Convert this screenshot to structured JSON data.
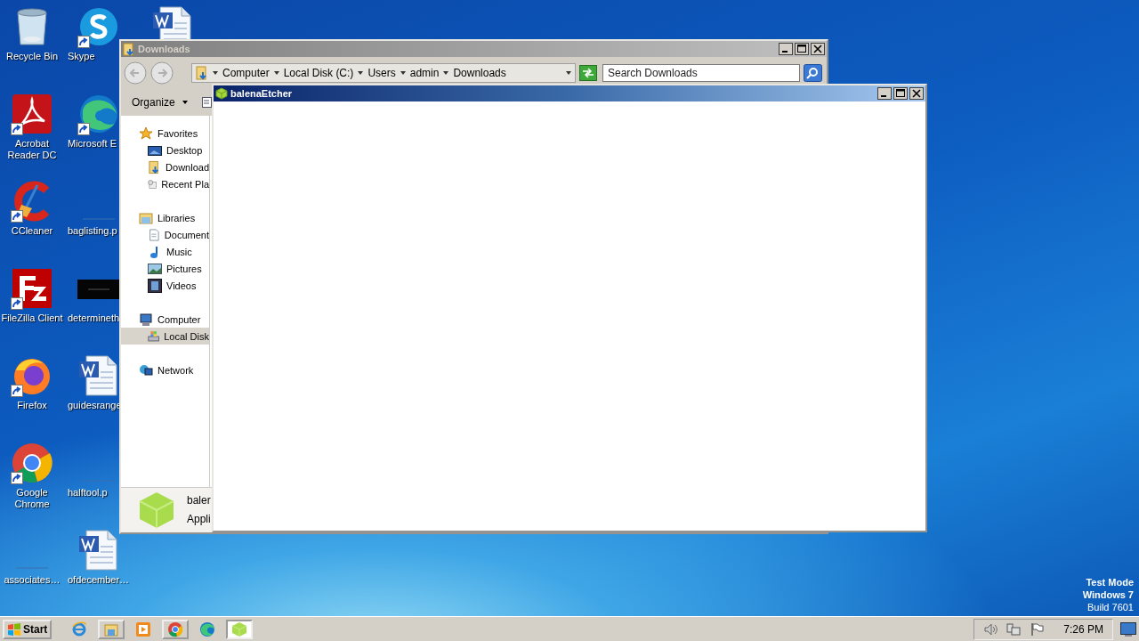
{
  "desktop_icons": [
    {
      "label": "Recycle Bin",
      "kind": "recycle",
      "shortcut": false
    },
    {
      "label": "Acrobat Reader DC",
      "kind": "pdf",
      "shortcut": true
    },
    {
      "label": "CCleaner",
      "kind": "ccleaner",
      "shortcut": true
    },
    {
      "label": "FileZilla Client",
      "kind": "filezilla",
      "shortcut": true
    },
    {
      "label": "Firefox",
      "kind": "firefox",
      "shortcut": true
    },
    {
      "label": "Google Chrome",
      "kind": "chrome",
      "shortcut": true
    },
    {
      "label": "associates…",
      "kind": "blank",
      "shortcut": false
    },
    {
      "label": "Skype",
      "kind": "skype",
      "shortcut": true
    },
    {
      "label": "Microsoft E",
      "kind": "edge",
      "shortcut": true
    },
    {
      "label": "baglisting.p",
      "kind": "blank",
      "shortcut": false
    },
    {
      "label": "determineth",
      "kind": "thumb",
      "shortcut": false
    },
    {
      "label": "guidesrange",
      "kind": "word",
      "shortcut": false
    },
    {
      "label": "halftool.p",
      "kind": "blank",
      "shortcut": false
    },
    {
      "label": "ofdecember…",
      "kind": "word",
      "shortcut": false
    },
    {
      "kind": "word",
      "shortcut": false
    }
  ],
  "explorer": {
    "title": "Downloads",
    "active": false,
    "breadcrumb": [
      "Computer",
      "Local Disk (C:)",
      "Users",
      "admin",
      "Downloads"
    ],
    "search": {
      "placeholder": "Search Downloads"
    },
    "toolbar": {
      "organize": "Organize"
    },
    "nav": [
      {
        "label": "Favorites",
        "kind": "star",
        "selected": false,
        "children": [
          {
            "label": "Desktop",
            "kind": "desktop",
            "selected": false
          },
          {
            "label": "Download",
            "kind": "folder",
            "selected": false
          },
          {
            "label": "Recent Pla",
            "kind": "recent",
            "selected": false
          }
        ]
      },
      {
        "label": "Libraries",
        "kind": "library",
        "selected": false,
        "children": [
          {
            "label": "Document",
            "kind": "document",
            "selected": false
          },
          {
            "label": "Music",
            "kind": "music",
            "selected": false
          },
          {
            "label": "Pictures",
            "kind": "pictures",
            "selected": false
          },
          {
            "label": "Videos",
            "kind": "videos",
            "selected": false
          }
        ]
      },
      {
        "label": "Computer",
        "kind": "computer",
        "selected": false,
        "children": [
          {
            "label": "Local Disk",
            "kind": "disk",
            "selected": true
          }
        ]
      },
      {
        "label": "Network",
        "kind": "network",
        "selected": false
      }
    ],
    "details": {
      "name": "baler",
      "type": "Appli"
    }
  },
  "etcher": {
    "title": "balenaEtcher",
    "active": true
  },
  "system_text": [
    "Test Mode",
    "Windows 7",
    "Build 7601"
  ],
  "taskbar": {
    "start": "Start",
    "items": [
      {
        "kind": "ie",
        "running": false,
        "selected": false
      },
      {
        "kind": "explorer",
        "running": true,
        "selected": false
      },
      {
        "kind": "media",
        "running": false,
        "selected": false
      },
      {
        "kind": "chrome",
        "running": true,
        "selected": false
      },
      {
        "kind": "edge",
        "running": false,
        "selected": false
      },
      {
        "kind": "etcher",
        "running": true,
        "selected": true
      }
    ],
    "clock": "7:26 PM"
  }
}
